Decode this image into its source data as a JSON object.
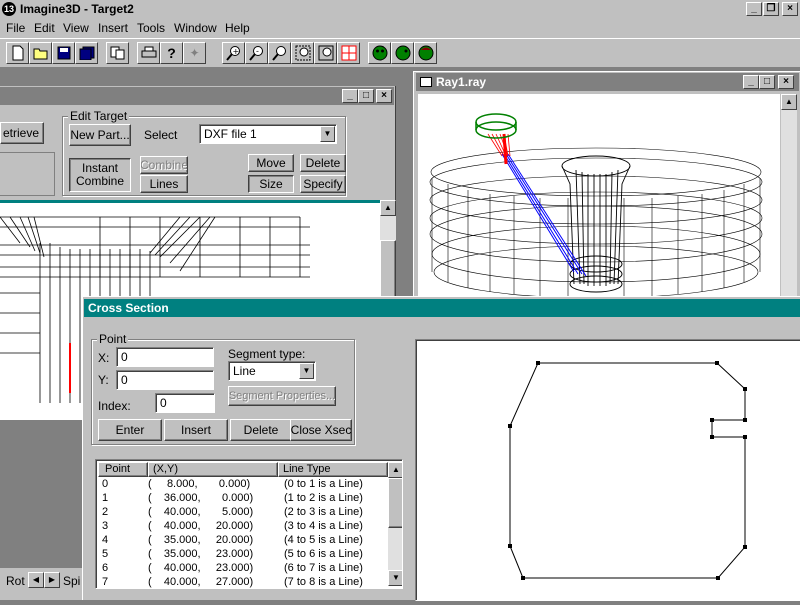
{
  "app": {
    "title": "Imagine3D - Target2",
    "icon_name": "app-3d-icon"
  },
  "menu": [
    {
      "label": "File",
      "key": "F"
    },
    {
      "label": "Edit",
      "key": "E"
    },
    {
      "label": "View",
      "key": "V"
    },
    {
      "label": "Insert",
      "key": "I"
    },
    {
      "label": "Tools",
      "key": "T"
    },
    {
      "label": "Window",
      "key": "W"
    },
    {
      "label": "Help",
      "key": "H"
    }
  ],
  "toolbar": {
    "icons": [
      "new-file-icon",
      "open-folder-icon",
      "save-icon",
      "save-all-icon",
      "copy-icon",
      "print-icon",
      "help-icon",
      "pointer-icon",
      "zoom-in-icon",
      "zoom-out-icon",
      "zoom-fit-icon",
      "zoom-window-icon",
      "zoom-extents-icon",
      "grid-icon",
      "head-front-icon",
      "head-side-icon",
      "head-back-icon"
    ]
  },
  "target_window": {
    "retrieve_label": "etrieve",
    "edit_target_label": "Edit Target",
    "new_part_label": "New Part...",
    "select_label": "Select",
    "select_value": "DXF file 1",
    "instant_combine_label": "Instant\nCombine",
    "combine_label": "Combine",
    "lines_label": "Lines",
    "move_label": "Move",
    "delete_label": "Delete",
    "size_label": "Size",
    "specify_label": "Specify"
  },
  "ray_window": {
    "title": "Ray1.ray"
  },
  "status": {
    "rot_label": "Rot",
    "spin_label": "Spi"
  },
  "cross_section": {
    "title": "Cross Section",
    "point_group_label": "Point",
    "x_label": "X:",
    "x_value": "0",
    "y_label": "Y:",
    "y_value": "0",
    "index_label": "Index:",
    "index_value": "0",
    "segment_type_label": "Segment type:",
    "segment_type_value": "Line",
    "segment_properties_label": "Segment Properties...",
    "enter_label": "Enter",
    "insert_label": "Insert",
    "delete_label": "Delete",
    "close_label": "Close Xsec",
    "columns": [
      "Point",
      "(X,Y)",
      "Line Type"
    ],
    "rows": [
      {
        "point": "0",
        "xy": "(     8.000,       0.000)",
        "line": "(0 to 1 is a Line)"
      },
      {
        "point": "1",
        "xy": "(    36.000,       0.000)",
        "line": "(1 to 2 is a Line)"
      },
      {
        "point": "2",
        "xy": "(    40.000,       5.000)",
        "line": "(2 to 3 is a Line)"
      },
      {
        "point": "3",
        "xy": "(    40.000,     20.000)",
        "line": "(3 to 4 is a Line)"
      },
      {
        "point": "4",
        "xy": "(    35.000,     20.000)",
        "line": "(4 to 5 is a Line)"
      },
      {
        "point": "5",
        "xy": "(    35.000,     23.000)",
        "line": "(5 to 6 is a Line)"
      },
      {
        "point": "6",
        "xy": "(    40.000,     23.000)",
        "line": "(6 to 7 is a Line)"
      },
      {
        "point": "7",
        "xy": "(    40.000,     27.000)",
        "line": "(7 to 8 is a Line)"
      }
    ]
  },
  "colors": {
    "active_title": "#008080",
    "inactive_title": "#808080",
    "face": "#c0c0c0",
    "ray_blue": "#0000ff",
    "ray_red": "#ff0000",
    "camera_green": "#008000"
  }
}
